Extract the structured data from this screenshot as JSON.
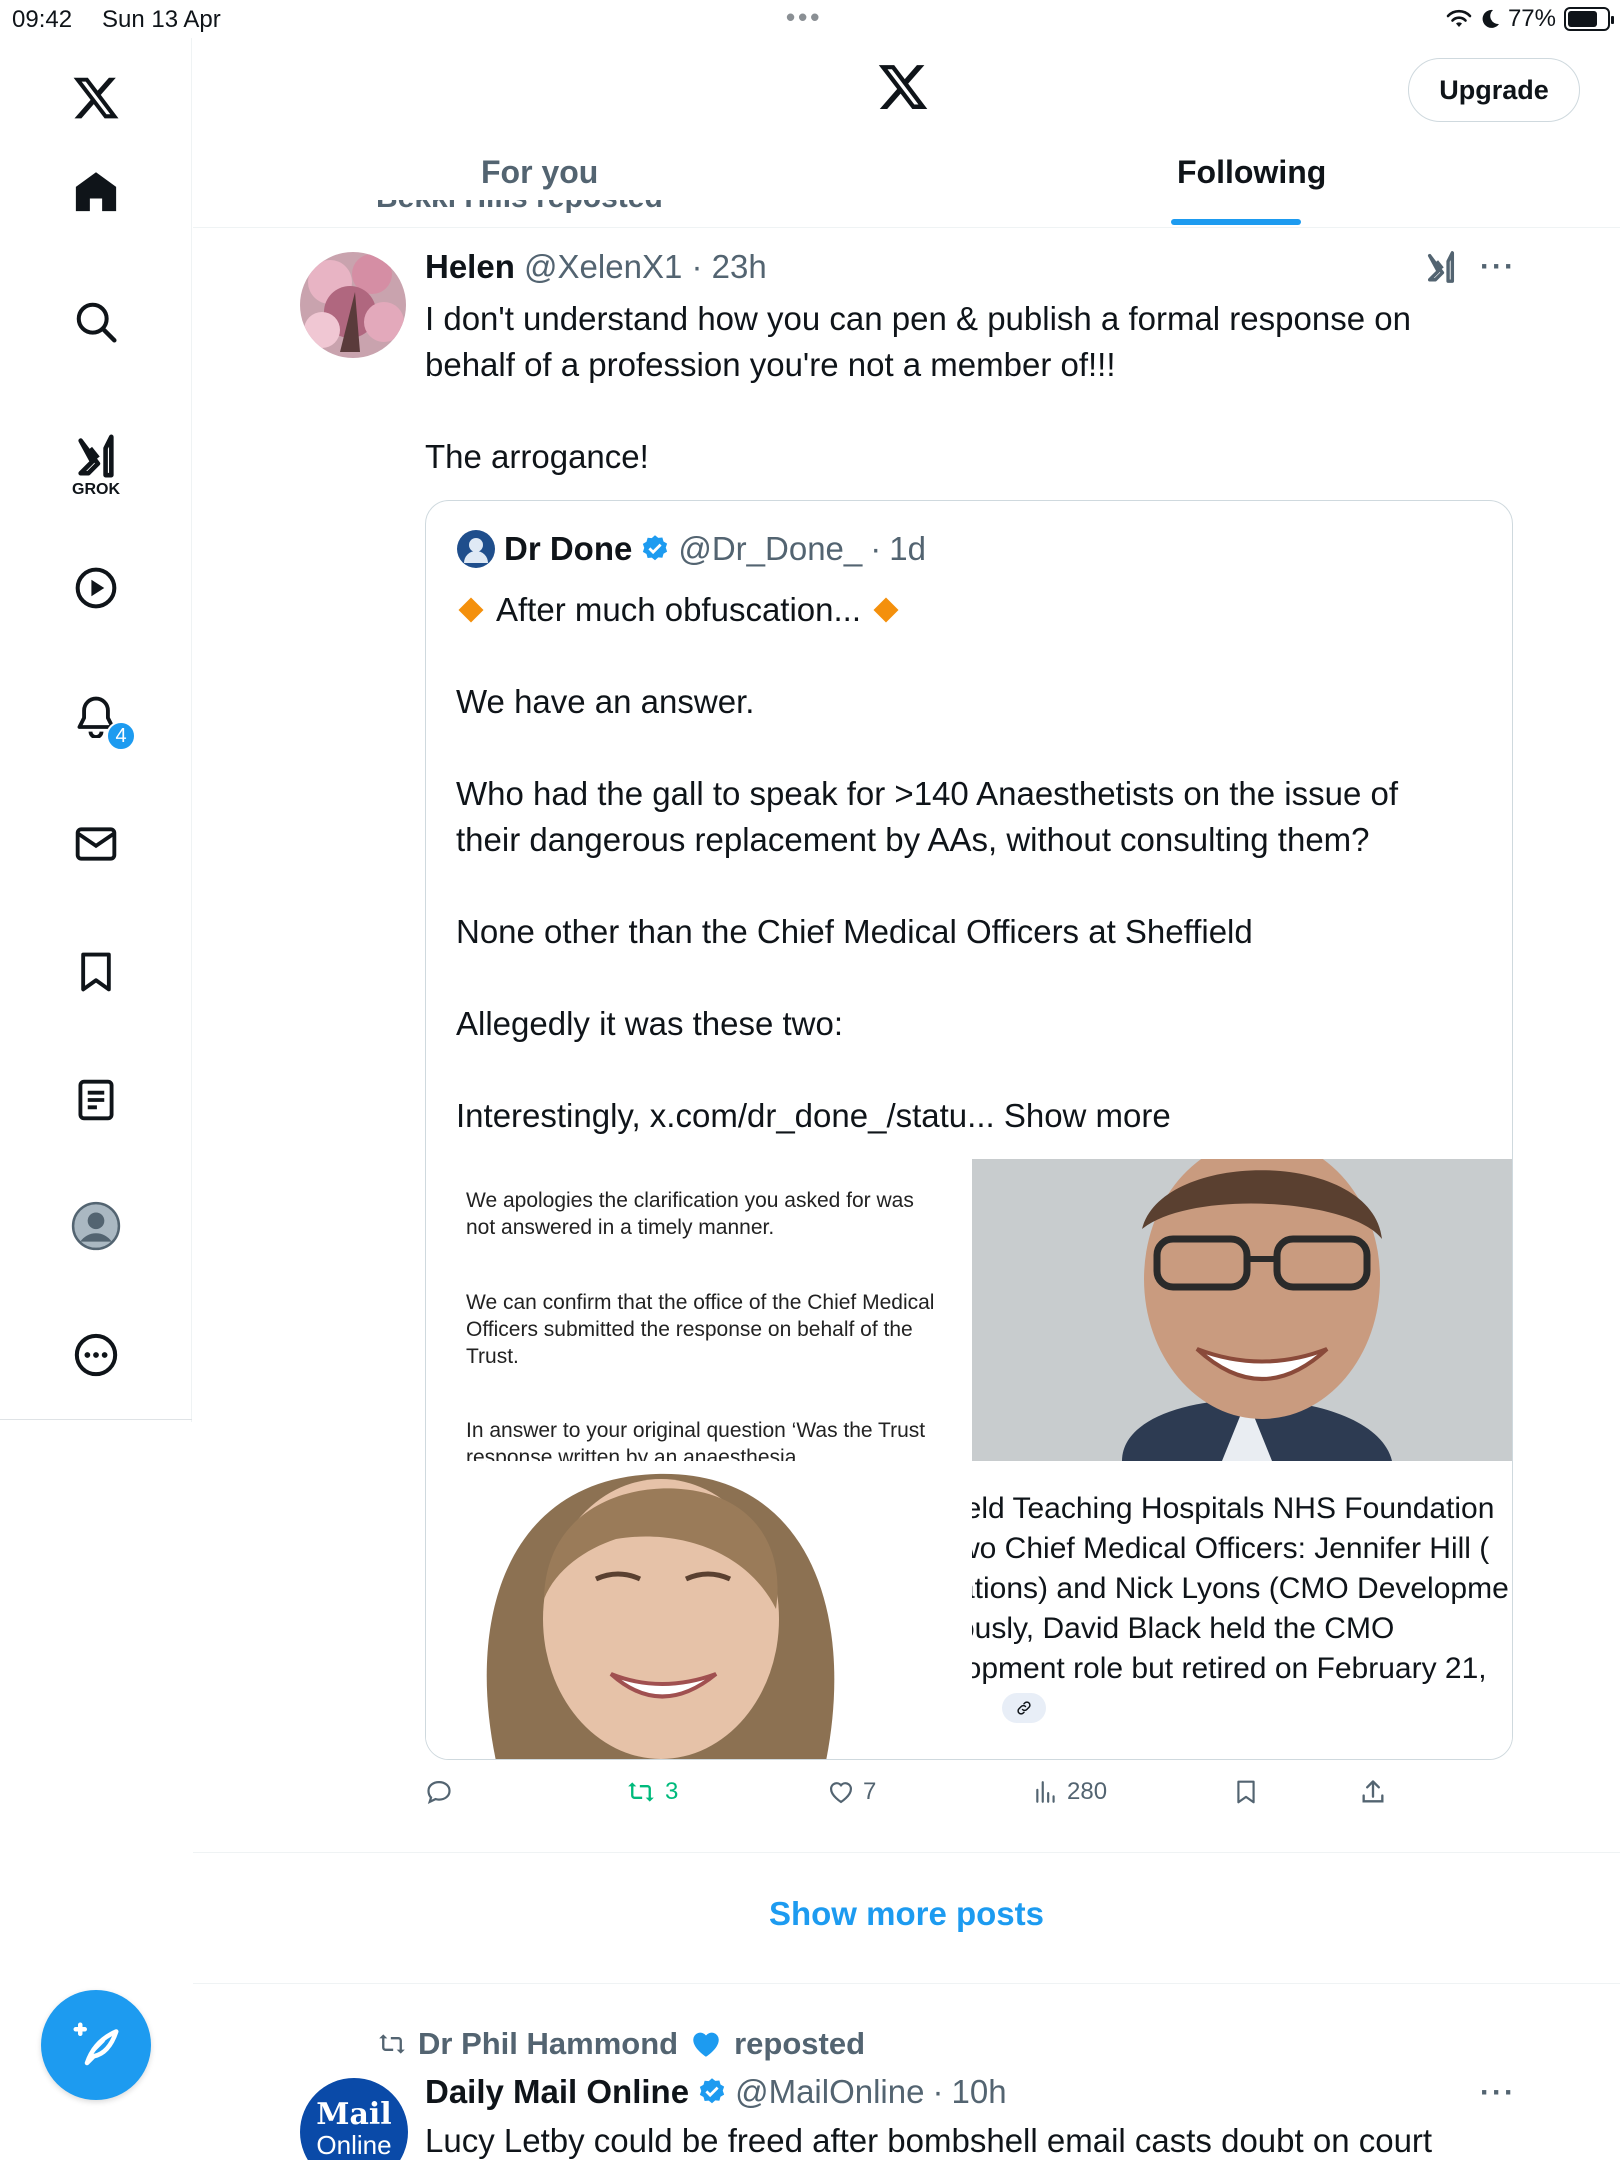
{
  "status_bar": {
    "time": "09:42",
    "date": "Sun 13 Apr",
    "battery": "77%",
    "battery_level": 0.77
  },
  "sidebar": {
    "grok_label": "GROK",
    "notification_count": "4",
    "icons": [
      "x-logo-icon",
      "home-icon",
      "search-icon",
      "grok-icon",
      "video-icon",
      "bell-icon",
      "mail-icon",
      "bookmark-icon",
      "lists-icon",
      "profile-icon",
      "more-icon"
    ]
  },
  "header": {
    "upgrade_label": "Upgrade",
    "tabs": [
      {
        "label": "For you",
        "active": false
      },
      {
        "label": "Following",
        "active": true
      }
    ]
  },
  "feed": {
    "cutoff_text": "Bekki Hills reposted",
    "tweet": {
      "name": "Helen",
      "handle": "@XelenX1",
      "time": "23h",
      "text_line1": "I don't understand how you can pen & publish a formal response on",
      "text_line2": "behalf of a profession you're not a member of!!!",
      "text_line3": "The arrogance!",
      "quote": {
        "name": "Dr Done",
        "handle": "@Dr_Done_",
        "time": "1d",
        "line1": "After much obfuscation...",
        "line2": "We have an answer.",
        "line3": "Who had the gall to speak for >140 Anaesthetists on the issue of",
        "line4": "their dangerous replacement by AAs, without consulting them?",
        "line5": "None other than the Chief Medical Officers at  Sheffield",
        "line6": "Allegedly it was these two:",
        "line7": "Interestingly, x.com/dr_done_/statu...",
        "show_more": "Show more",
        "doc": {
          "p1": "We apologies the clarification you asked for was not answered in a timely manner.",
          "p2": "We can confirm that the office of the Chief Medical Officers submitted the response on behalf of the Trust.",
          "p3": "In answer to your original question ‘Was the Trust response written by an anaesthesia"
        },
        "article_lines": [
          "ield Teaching Hospitals NHS Foundation",
          "wo Chief Medical Officers: Jennifer Hill (",
          "ations) and Nick Lyons (CMO Developme",
          "ously, David Black held the CMO",
          "lopment role but retired on February 21,"
        ]
      },
      "actions": {
        "replies": "",
        "reposts": "3",
        "likes": "7",
        "views": "280"
      }
    },
    "show_more_posts": "Show more posts",
    "tweet2": {
      "reposted_by": "Dr Phil Hammond",
      "reposted_suffix": "reposted",
      "name": "Daily Mail Online",
      "handle": "@MailOnline",
      "time": "10h",
      "text": "Lucy Letby could be freed after bombshell email casts doubt on court",
      "avatar_top": "Mail",
      "avatar_bottom": "Online"
    }
  },
  "colors": {
    "accent": "#1d9bf0",
    "repost_green": "#00ba7c",
    "muted": "#536471"
  }
}
